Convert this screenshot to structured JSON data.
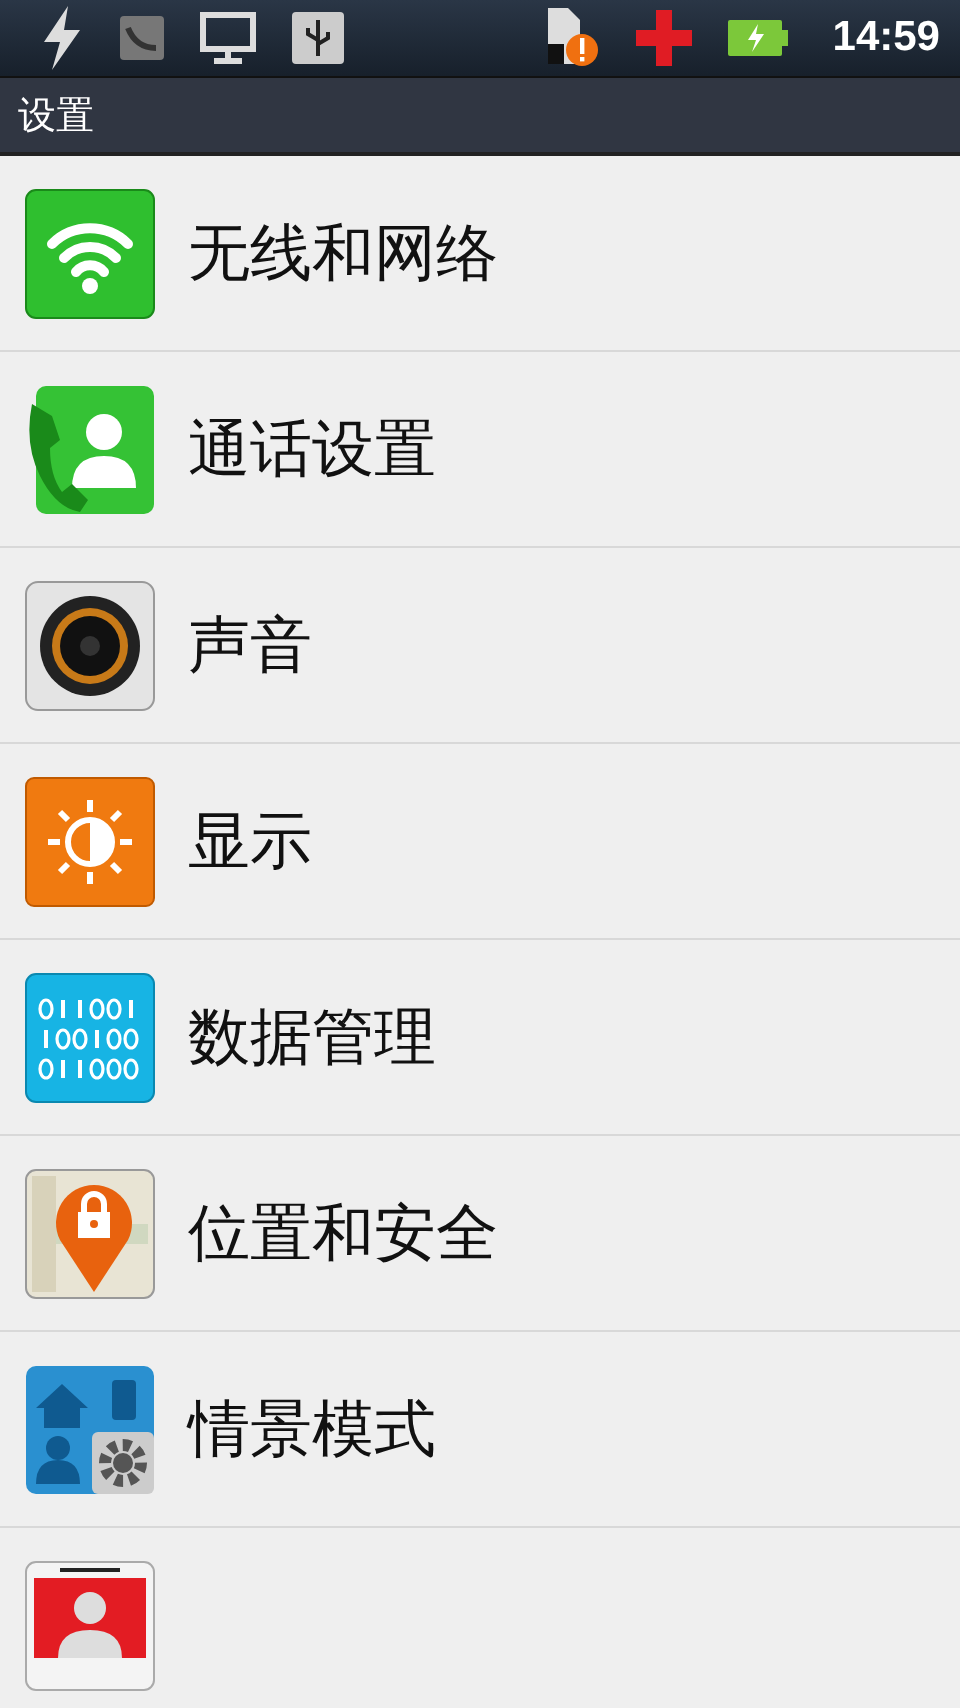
{
  "status_bar": {
    "time": "14:59"
  },
  "title": "设置",
  "items": [
    {
      "label": "无线和网络"
    },
    {
      "label": "通话设置"
    },
    {
      "label": "声音"
    },
    {
      "label": "显示"
    },
    {
      "label": "数据管理"
    },
    {
      "label": "位置和安全"
    },
    {
      "label": "情景模式"
    }
  ]
}
